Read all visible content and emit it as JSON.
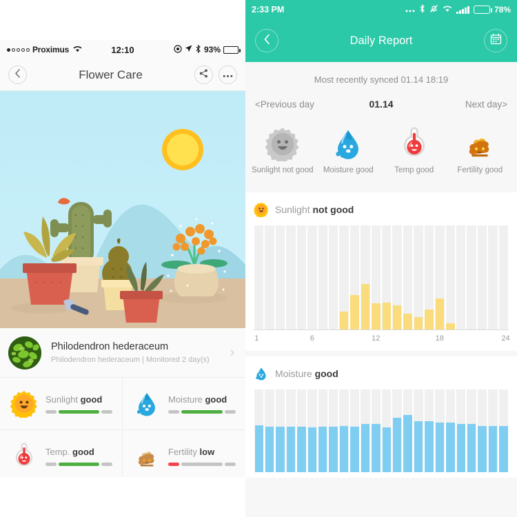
{
  "left_phone": {
    "status_bar": {
      "carrier": "Proximus",
      "signal_dots": 1,
      "time": "12:10",
      "battery_percent": "93%",
      "icons": [
        "alarm-icon",
        "location-arrow-icon",
        "bluetooth-icon"
      ]
    },
    "nav": {
      "back_icon": "chevron-left-icon",
      "title": "Flower Care",
      "share_icon": "share-icon",
      "more_icon": "more-dots-icon"
    },
    "hero": {
      "illustration": "desert-plants-illustration",
      "sun_icon": "sun-icon"
    },
    "plant_card": {
      "thumbnail": "plant-photo-thumbnail",
      "name": "Philodendron hederaceum",
      "subtitle": "Philodendron hederaceum  |  Monitored 2 day(s)",
      "chevron": "chevron-right-icon"
    },
    "tiles": [
      {
        "icon": "sun-face-icon",
        "metric": "Sunlight",
        "status": "good",
        "state": "good"
      },
      {
        "icon": "water-drop-face-icon",
        "metric": "Moisture",
        "status": "good",
        "state": "good"
      },
      {
        "icon": "thermometer-face-icon",
        "metric": "Temp.",
        "status": "good",
        "state": "good"
      },
      {
        "icon": "fertility-face-icon",
        "metric": "Fertility",
        "status": "low",
        "state": "low"
      }
    ]
  },
  "right_phone": {
    "status_bar": {
      "time": "2:33 PM",
      "battery_percent": "78%",
      "icons": [
        "more-dots-icon",
        "bluetooth-icon",
        "mute-bell-icon",
        "wifi-icon",
        "signal-icon",
        "battery-icon"
      ]
    },
    "nav": {
      "back_icon": "chevron-left-icon",
      "title": "Daily Report",
      "calendar_icon": "calendar-icon"
    },
    "sync_text": "Most recently synced 01.14 18:19",
    "day_nav": {
      "prev_label": "<Previous day",
      "current_date": "01.14",
      "next_label": "Next day>"
    },
    "status_items": [
      {
        "icon": "sun-face-gray-icon",
        "label": "Sunlight not good"
      },
      {
        "icon": "water-drop-face-icon",
        "label": "Moisture good"
      },
      {
        "icon": "thermometer-face-icon",
        "label": "Temp good"
      },
      {
        "icon": "fertility-face-icon",
        "label": "Fertility good"
      }
    ],
    "charts": [
      {
        "icon": "sun-face-icon",
        "metric": "Sunlight",
        "status": "not good"
      },
      {
        "icon": "water-drop-face-icon",
        "metric": "Moisture",
        "status": "good"
      }
    ]
  },
  "colors": {
    "teal_header": "#2BC9A8",
    "sun_bar": "#FADC7C",
    "moisture_bar": "#7FCEF2",
    "good_green": "#4CAF3F",
    "low_red": "#F4434A",
    "track_gray": "#F0F0F0",
    "sky_blue": "#C6EEF8",
    "ground_tan": "#D8C0A0"
  },
  "chart_data": [
    {
      "type": "bar",
      "title": "Sunlight not good",
      "xlabel": "",
      "ylabel": "",
      "categories": [
        1,
        2,
        3,
        4,
        5,
        6,
        7,
        8,
        9,
        10,
        11,
        12,
        13,
        14,
        15,
        16,
        17,
        18,
        19,
        20,
        21,
        22,
        23,
        24
      ],
      "values": [
        0,
        0,
        0,
        0,
        0,
        0,
        0,
        0,
        17,
        33,
        44,
        25,
        26,
        23,
        15,
        12,
        19,
        30,
        6,
        0,
        0,
        0,
        0,
        0
      ],
      "tick_labels": [
        "1",
        "6",
        "12",
        "18",
        "24"
      ],
      "tick_positions": [
        1,
        6,
        12,
        18,
        24
      ],
      "ylim": [
        0,
        100
      ],
      "grid": false,
      "legend": "none",
      "series_color": "#FADC7C"
    },
    {
      "type": "bar",
      "title": "Moisture good",
      "xlabel": "",
      "ylabel": "",
      "categories": [
        1,
        2,
        3,
        4,
        5,
        6,
        7,
        8,
        9,
        10,
        11,
        12,
        13,
        14,
        15,
        16,
        17,
        18,
        19,
        20,
        21,
        22,
        23,
        24
      ],
      "values": [
        57,
        55,
        55,
        55,
        55,
        54,
        55,
        55,
        56,
        55,
        58,
        58,
        54,
        66,
        69,
        62,
        62,
        60,
        60,
        58,
        58,
        56,
        56,
        56
      ],
      "ylim": [
        0,
        100
      ],
      "grid": false,
      "legend": "none",
      "series_color": "#7FCEF2"
    }
  ]
}
